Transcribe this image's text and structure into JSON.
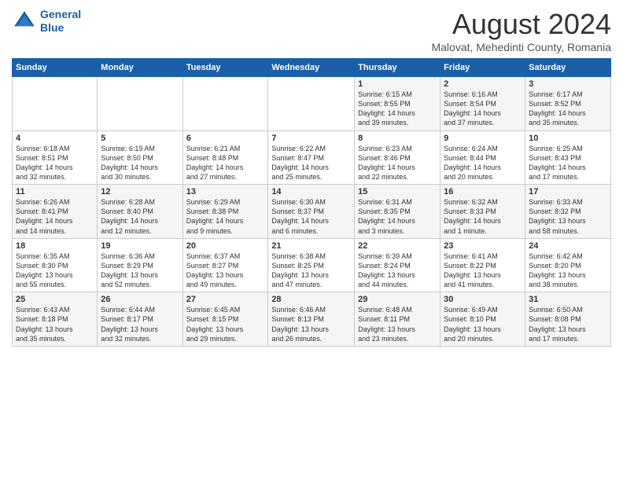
{
  "logo": {
    "line1": "General",
    "line2": "Blue"
  },
  "title": "August 2024",
  "subtitle": "Malovat, Mehedinti County, Romania",
  "days_header": [
    "Sunday",
    "Monday",
    "Tuesday",
    "Wednesday",
    "Thursday",
    "Friday",
    "Saturday"
  ],
  "weeks": [
    [
      {
        "day": "",
        "info": ""
      },
      {
        "day": "",
        "info": ""
      },
      {
        "day": "",
        "info": ""
      },
      {
        "day": "",
        "info": ""
      },
      {
        "day": "1",
        "info": "Sunrise: 6:15 AM\nSunset: 8:55 PM\nDaylight: 14 hours\nand 39 minutes."
      },
      {
        "day": "2",
        "info": "Sunrise: 6:16 AM\nSunset: 8:54 PM\nDaylight: 14 hours\nand 37 minutes."
      },
      {
        "day": "3",
        "info": "Sunrise: 6:17 AM\nSunset: 8:52 PM\nDaylight: 14 hours\nand 35 minutes."
      }
    ],
    [
      {
        "day": "4",
        "info": "Sunrise: 6:18 AM\nSunset: 8:51 PM\nDaylight: 14 hours\nand 32 minutes."
      },
      {
        "day": "5",
        "info": "Sunrise: 6:19 AM\nSunset: 8:50 PM\nDaylight: 14 hours\nand 30 minutes."
      },
      {
        "day": "6",
        "info": "Sunrise: 6:21 AM\nSunset: 8:48 PM\nDaylight: 14 hours\nand 27 minutes."
      },
      {
        "day": "7",
        "info": "Sunrise: 6:22 AM\nSunset: 8:47 PM\nDaylight: 14 hours\nand 25 minutes."
      },
      {
        "day": "8",
        "info": "Sunrise: 6:23 AM\nSunset: 8:46 PM\nDaylight: 14 hours\nand 22 minutes."
      },
      {
        "day": "9",
        "info": "Sunrise: 6:24 AM\nSunset: 8:44 PM\nDaylight: 14 hours\nand 20 minutes."
      },
      {
        "day": "10",
        "info": "Sunrise: 6:25 AM\nSunset: 8:43 PM\nDaylight: 14 hours\nand 17 minutes."
      }
    ],
    [
      {
        "day": "11",
        "info": "Sunrise: 6:26 AM\nSunset: 8:41 PM\nDaylight: 14 hours\nand 14 minutes."
      },
      {
        "day": "12",
        "info": "Sunrise: 6:28 AM\nSunset: 8:40 PM\nDaylight: 14 hours\nand 12 minutes."
      },
      {
        "day": "13",
        "info": "Sunrise: 6:29 AM\nSunset: 8:38 PM\nDaylight: 14 hours\nand 9 minutes."
      },
      {
        "day": "14",
        "info": "Sunrise: 6:30 AM\nSunset: 8:37 PM\nDaylight: 14 hours\nand 6 minutes."
      },
      {
        "day": "15",
        "info": "Sunrise: 6:31 AM\nSunset: 8:35 PM\nDaylight: 14 hours\nand 3 minutes."
      },
      {
        "day": "16",
        "info": "Sunrise: 6:32 AM\nSunset: 8:33 PM\nDaylight: 14 hours\nand 1 minute."
      },
      {
        "day": "17",
        "info": "Sunrise: 6:33 AM\nSunset: 8:32 PM\nDaylight: 13 hours\nand 58 minutes."
      }
    ],
    [
      {
        "day": "18",
        "info": "Sunrise: 6:35 AM\nSunset: 8:30 PM\nDaylight: 13 hours\nand 55 minutes."
      },
      {
        "day": "19",
        "info": "Sunrise: 6:36 AM\nSunset: 8:29 PM\nDaylight: 13 hours\nand 52 minutes."
      },
      {
        "day": "20",
        "info": "Sunrise: 6:37 AM\nSunset: 8:27 PM\nDaylight: 13 hours\nand 49 minutes."
      },
      {
        "day": "21",
        "info": "Sunrise: 6:38 AM\nSunset: 8:25 PM\nDaylight: 13 hours\nand 47 minutes."
      },
      {
        "day": "22",
        "info": "Sunrise: 6:39 AM\nSunset: 8:24 PM\nDaylight: 13 hours\nand 44 minutes."
      },
      {
        "day": "23",
        "info": "Sunrise: 6:41 AM\nSunset: 8:22 PM\nDaylight: 13 hours\nand 41 minutes."
      },
      {
        "day": "24",
        "info": "Sunrise: 6:42 AM\nSunset: 8:20 PM\nDaylight: 13 hours\nand 38 minutes."
      }
    ],
    [
      {
        "day": "25",
        "info": "Sunrise: 6:43 AM\nSunset: 8:18 PM\nDaylight: 13 hours\nand 35 minutes."
      },
      {
        "day": "26",
        "info": "Sunrise: 6:44 AM\nSunset: 8:17 PM\nDaylight: 13 hours\nand 32 minutes."
      },
      {
        "day": "27",
        "info": "Sunrise: 6:45 AM\nSunset: 8:15 PM\nDaylight: 13 hours\nand 29 minutes."
      },
      {
        "day": "28",
        "info": "Sunrise: 6:46 AM\nSunset: 8:13 PM\nDaylight: 13 hours\nand 26 minutes."
      },
      {
        "day": "29",
        "info": "Sunrise: 6:48 AM\nSunset: 8:11 PM\nDaylight: 13 hours\nand 23 minutes."
      },
      {
        "day": "30",
        "info": "Sunrise: 6:49 AM\nSunset: 8:10 PM\nDaylight: 13 hours\nand 20 minutes."
      },
      {
        "day": "31",
        "info": "Sunrise: 6:50 AM\nSunset: 8:08 PM\nDaylight: 13 hours\nand 17 minutes."
      }
    ]
  ]
}
